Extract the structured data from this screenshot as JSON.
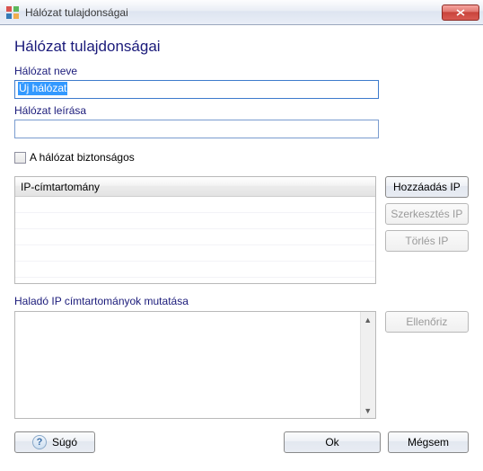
{
  "window": {
    "title": "Hálózat tulajdonságai"
  },
  "heading": "Hálózat tulajdonságai",
  "fields": {
    "name_label": "Hálózat neve",
    "name_value": "Új hálózat",
    "desc_label": "Hálózat leírása",
    "desc_value": ""
  },
  "checkbox": {
    "secure_label": "A hálózat biztonságos",
    "checked": false
  },
  "ip_table": {
    "header": "IP-címtartomány",
    "rows": []
  },
  "buttons": {
    "add_ip": "Hozzáadás IP",
    "edit_ip": "Szerkesztés IP",
    "delete_ip": "Törlés IP",
    "verify": "Ellenőriz",
    "help": "Súgó",
    "ok": "Ok",
    "cancel": "Mégsem"
  },
  "advanced": {
    "label": "Haladó IP címtartományok mutatása",
    "value": ""
  }
}
